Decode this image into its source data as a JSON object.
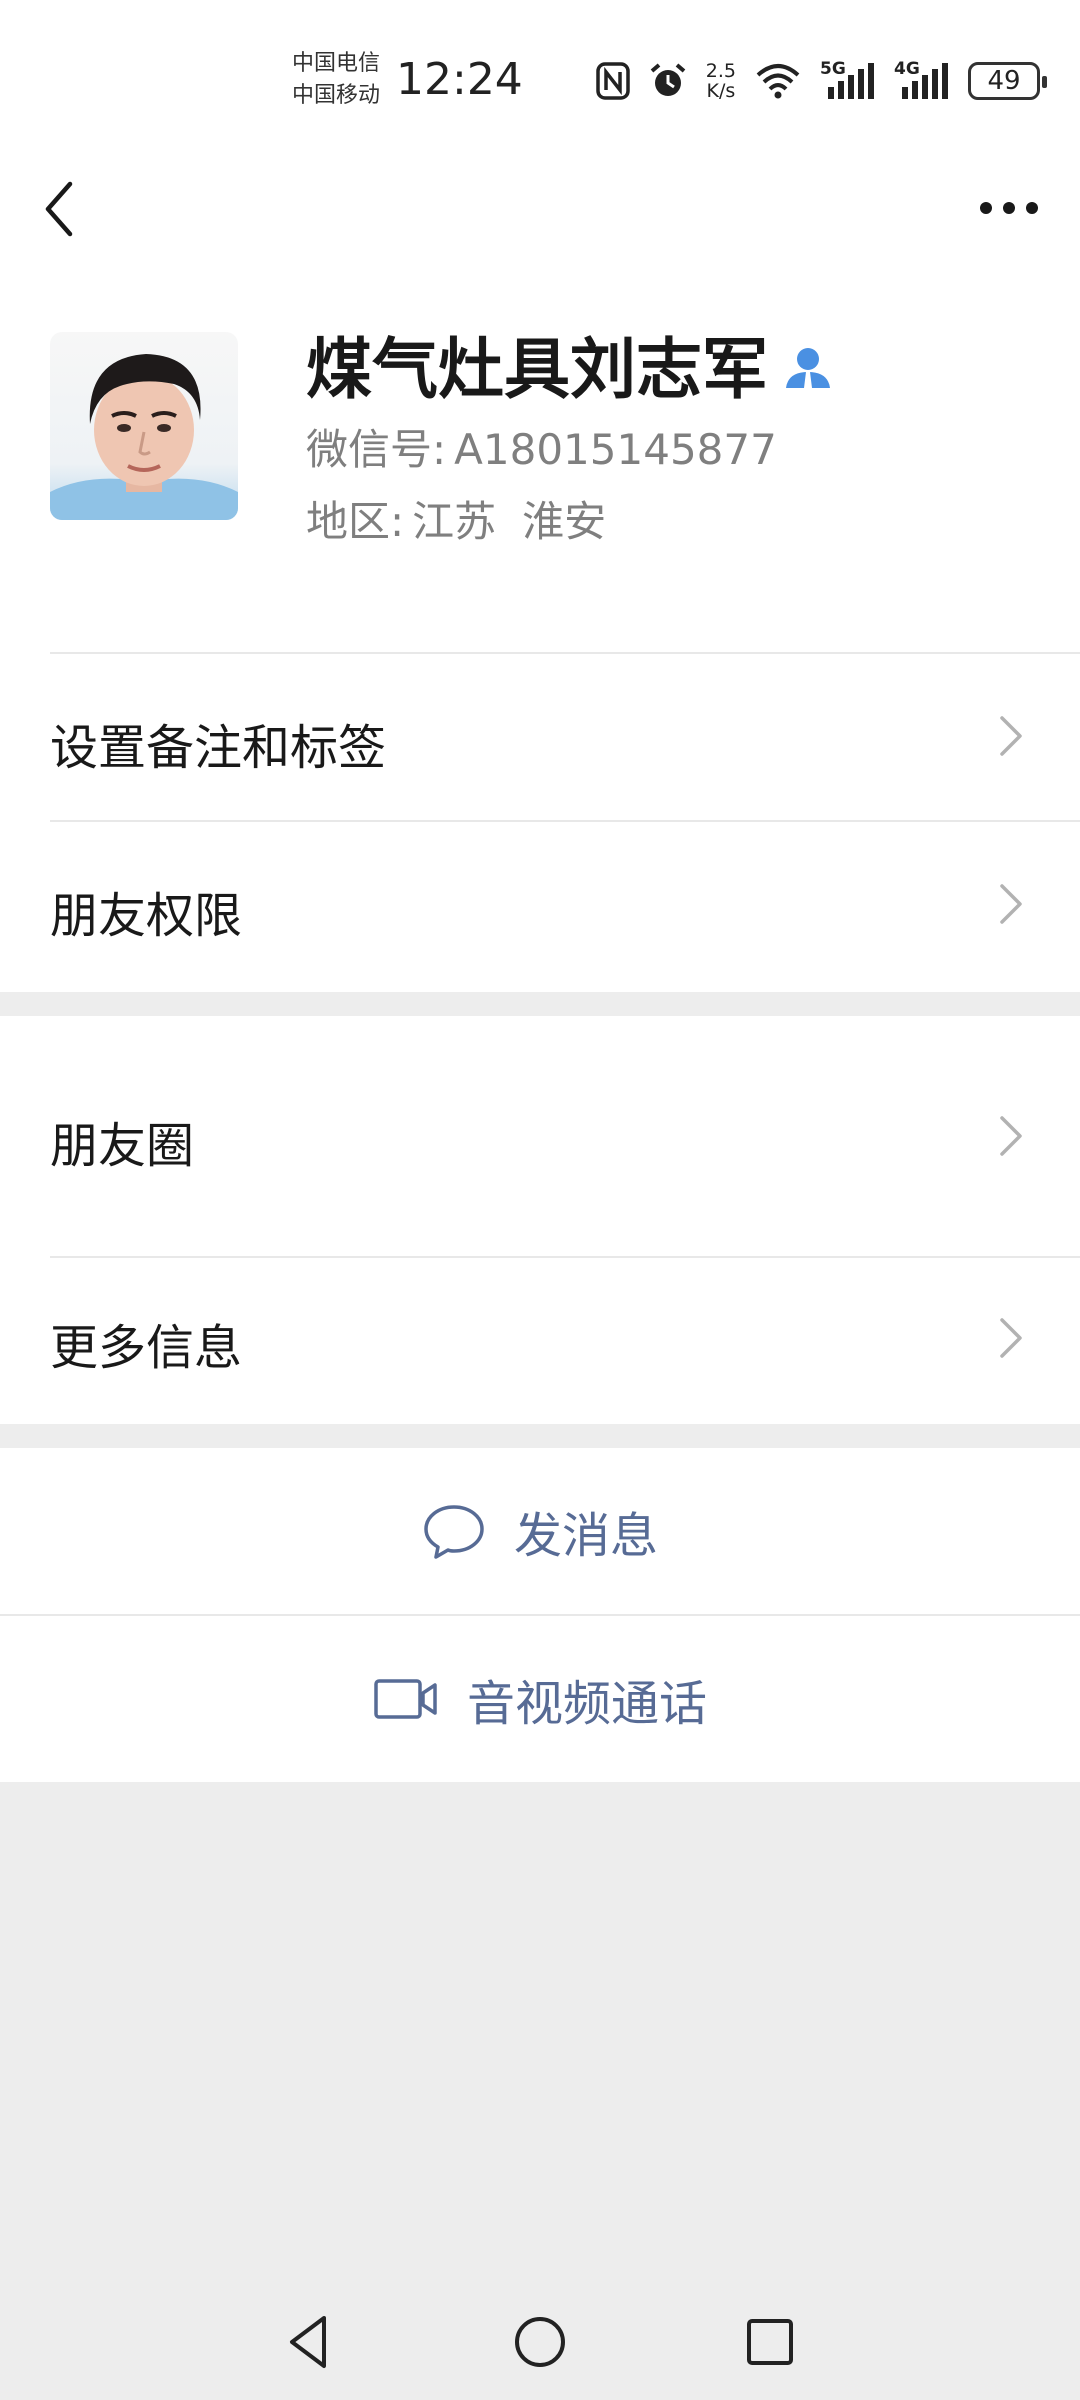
{
  "status_bar": {
    "carrier_1": "中国电信",
    "carrier_2": "中国移动",
    "time": "12:24",
    "speed_value": "2.5",
    "speed_unit": "K/s",
    "net_5g": "5G",
    "net_4g": "4G",
    "battery": "49",
    "icons": [
      "nfc-icon",
      "alarm-icon",
      "wifi-icon",
      "signal-icon",
      "battery-icon"
    ]
  },
  "header": {
    "back_icon": "chevron-left-icon",
    "more_icon": "more-dots-icon"
  },
  "profile": {
    "name": "煤气灶具刘志军",
    "wechat_id_label": "微信号:",
    "wechat_id": "A18015145877",
    "region_label": "地区:",
    "region_province": "江苏",
    "region_city": "淮安",
    "badge_icon": "person-icon"
  },
  "menu": {
    "remark_tags": "设置备注和标签",
    "friend_permissions": "朋友权限",
    "moments": "朋友圈",
    "more_info": "更多信息"
  },
  "actions": {
    "send_message": "发消息",
    "av_call": "音视频通话"
  },
  "colors": {
    "link_blue": "#576b95",
    "page_bg": "#ededed",
    "badge_blue": "#4a90e2"
  }
}
